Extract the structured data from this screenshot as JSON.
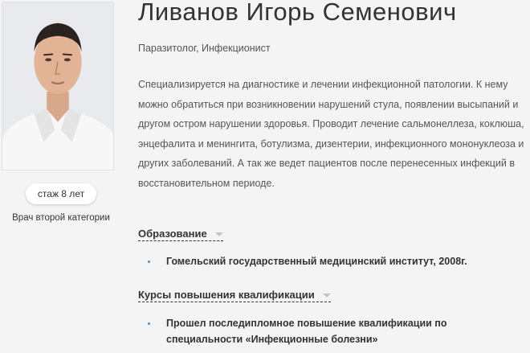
{
  "doctor": {
    "name": "Ливанов Игорь Семенович",
    "specialty": "Паразитолог, Инфекционист",
    "bio": "Специализируется на диагностике и лечении инфекционной патологии. К нему можно обратиться при возникновении нарушений стула, появлении высыпаний и другом остром нарушении здоровья. Проводит лечение сальмонеллеза, коклюша, энцефалита и менингита, ботулизма, дизентерии, инфекционного мононуклеоза и других заболеваний. А так же ведет пациентов после перенесенных инфекций в восстановительном периоде.",
    "experience": "стаж 8 лет",
    "category": "Врач второй категории"
  },
  "sections": {
    "education": {
      "title": "Образование",
      "items": [
        "Гомельский государственный медицинский институт, 2008г."
      ]
    },
    "courses": {
      "title": "Курсы повышения квалификации",
      "items": [
        "Прошел последипломное повышение квалификации по специальности «Инфекционные болезни»"
      ]
    }
  },
  "colors": {
    "background": "#f4f4f4",
    "bullet": "#3b8fd6",
    "caret": "#c4c4c4"
  },
  "icons": {
    "section_toggle": "caret-down-icon",
    "list_marker": "bullet-icon"
  }
}
